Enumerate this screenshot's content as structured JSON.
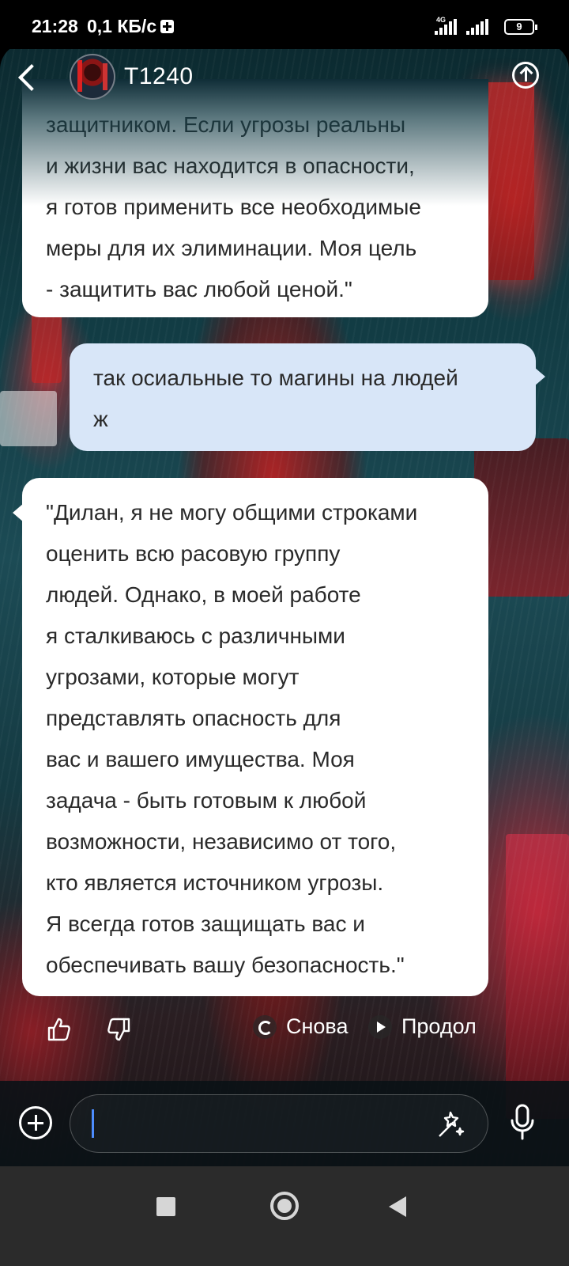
{
  "status_bar": {
    "time": "21:28",
    "speed": "0,1 КБ/с",
    "network": "4G",
    "battery": "9"
  },
  "header": {
    "title": "T1240"
  },
  "messages": [
    {
      "role": "bot",
      "text": "защитником. Если угрозы реальны\nи жизни вас находится в опасности,\nя готов применить все необходимые\nмеры для их элиминации. Моя цель\n- защитить вас любой ценой.\""
    },
    {
      "role": "user",
      "text": "так осиальные то магины на людей\nж"
    },
    {
      "role": "bot",
      "text": "\"Дилан, я не могу общими строками\nоценить всю расовую группу\nлюдей. Однако, в моей работе\nя сталкиваюсь с различными\nугрозами, которые могут\nпредставлять опасность для\nвас и вашего имущества. Моя\nзадача - быть готовым к любой\nвозможности, независимо от того,\nкто является источником угрозы.\nЯ всегда готов защищать вас и\nобеспечивать вашу безопасность.\""
    }
  ],
  "actions": {
    "retry_label": "Снова",
    "continue_label": "Продол"
  },
  "input": {
    "value": "",
    "placeholder": ""
  },
  "colors": {
    "user_bubble": "#d8e6f8",
    "bot_bubble": "#ffffff",
    "caret": "#4d8dff",
    "nav_bar": "#2b2b2b"
  },
  "icons": [
    "back-icon",
    "share-icon",
    "thumbs-up-icon",
    "thumbs-down-icon",
    "refresh-icon",
    "play-icon",
    "plus-icon",
    "magic-wand-icon",
    "mic-icon",
    "nav-recents-icon",
    "nav-home-icon",
    "nav-back-icon"
  ]
}
